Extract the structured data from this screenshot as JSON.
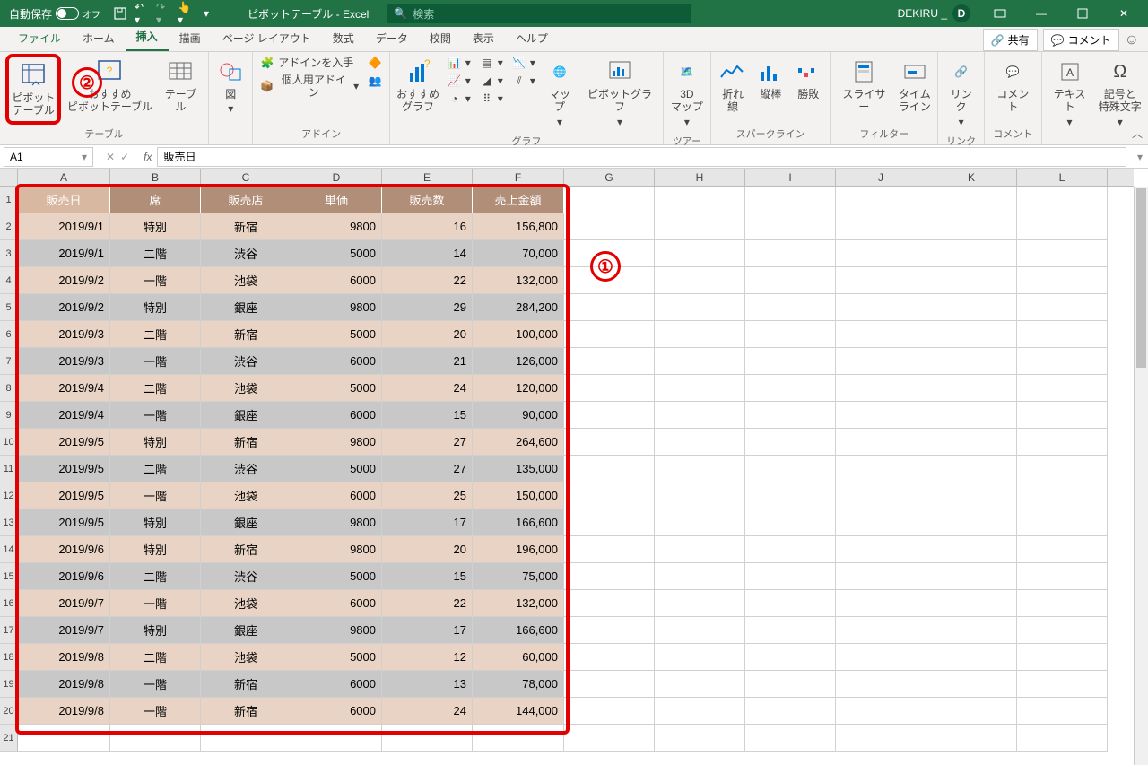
{
  "titlebar": {
    "autosave": "自動保存",
    "autosave_state": "オフ",
    "title": "ピボットテーブル - Excel",
    "search_placeholder": "検索",
    "user": "DEKIRU _",
    "user_initial": "D"
  },
  "tabs": {
    "file": "ファイル",
    "home": "ホーム",
    "insert": "挿入",
    "draw": "描画",
    "layout": "ページ レイアウト",
    "formula": "数式",
    "data": "データ",
    "review": "校閲",
    "view": "表示",
    "help": "ヘルプ",
    "share": "共有",
    "comment": "コメント"
  },
  "ribbon": {
    "pivot": "ピボット\nテーブル",
    "rec_pivot": "おすすめ\nピボットテーブル",
    "table": "テーブル",
    "group_table": "テーブル",
    "shapes": "図",
    "addin_get": "アドインを入手",
    "addin_my": "個人用アドイン",
    "group_addin": "アドイン",
    "rec_chart": "おすすめ\nグラフ",
    "map": "マップ",
    "pivot_chart": "ピボットグラフ",
    "group_chart": "グラフ",
    "map3d": "3D\nマップ",
    "group_tour": "ツアー",
    "sl_line": "折れ線",
    "sl_col": "縦棒",
    "sl_wl": "勝敗",
    "group_spark": "スパークライン",
    "slicer": "スライサー",
    "timeline": "タイム\nライン",
    "group_filter": "フィルター",
    "link": "リンク",
    "group_link": "リンク",
    "comment": "コメント",
    "group_comment": "コメント",
    "text": "テキスト",
    "symbol": "記号と\n特殊文字",
    "group_text": ""
  },
  "namebox": {
    "ref": "A1",
    "formula": "販売日"
  },
  "columns": [
    "A",
    "B",
    "C",
    "D",
    "E",
    "F",
    "G",
    "H",
    "I",
    "J",
    "K",
    "L"
  ],
  "headers": [
    "販売日",
    "席",
    "販売店",
    "単価",
    "販売数",
    "売上金額"
  ],
  "rows": [
    [
      "2019/9/1",
      "特別",
      "新宿",
      "9800",
      "16",
      "156,800"
    ],
    [
      "2019/9/1",
      "二階",
      "渋谷",
      "5000",
      "14",
      "70,000"
    ],
    [
      "2019/9/2",
      "一階",
      "池袋",
      "6000",
      "22",
      "132,000"
    ],
    [
      "2019/9/2",
      "特別",
      "銀座",
      "9800",
      "29",
      "284,200"
    ],
    [
      "2019/9/3",
      "二階",
      "新宿",
      "5000",
      "20",
      "100,000"
    ],
    [
      "2019/9/3",
      "一階",
      "渋谷",
      "6000",
      "21",
      "126,000"
    ],
    [
      "2019/9/4",
      "二階",
      "池袋",
      "5000",
      "24",
      "120,000"
    ],
    [
      "2019/9/4",
      "一階",
      "銀座",
      "6000",
      "15",
      "90,000"
    ],
    [
      "2019/9/5",
      "特別",
      "新宿",
      "9800",
      "27",
      "264,600"
    ],
    [
      "2019/9/5",
      "二階",
      "渋谷",
      "5000",
      "27",
      "135,000"
    ],
    [
      "2019/9/5",
      "一階",
      "池袋",
      "6000",
      "25",
      "150,000"
    ],
    [
      "2019/9/5",
      "特別",
      "銀座",
      "9800",
      "17",
      "166,600"
    ],
    [
      "2019/9/6",
      "特別",
      "新宿",
      "9800",
      "20",
      "196,000"
    ],
    [
      "2019/9/6",
      "二階",
      "渋谷",
      "5000",
      "15",
      "75,000"
    ],
    [
      "2019/9/7",
      "一階",
      "池袋",
      "6000",
      "22",
      "132,000"
    ],
    [
      "2019/9/7",
      "特別",
      "銀座",
      "9800",
      "17",
      "166,600"
    ],
    [
      "2019/9/8",
      "二階",
      "池袋",
      "5000",
      "12",
      "60,000"
    ],
    [
      "2019/9/8",
      "一階",
      "新宿",
      "6000",
      "13",
      "78,000"
    ],
    [
      "2019/9/8",
      "一階",
      "新宿",
      "6000",
      "24",
      "144,000"
    ]
  ],
  "annotations": {
    "n1": "①",
    "n2": "②"
  }
}
